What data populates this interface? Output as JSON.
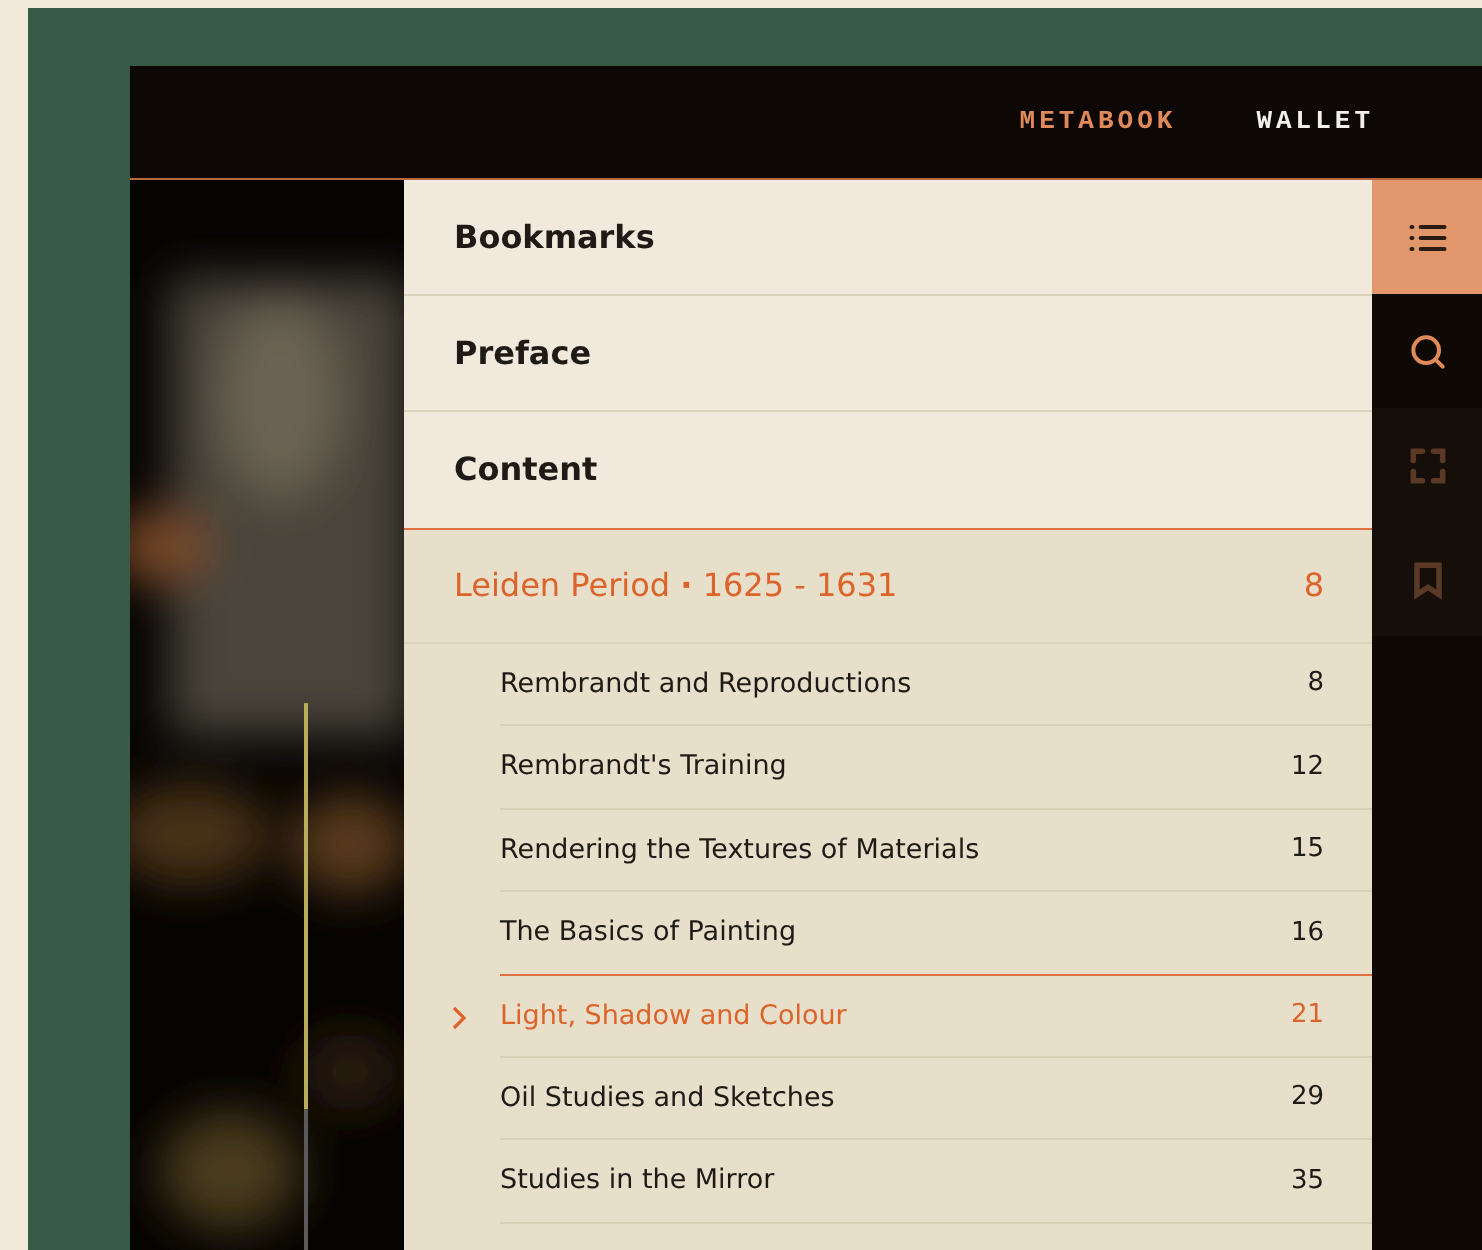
{
  "header": {
    "tabs": [
      {
        "label": "METABOOK",
        "selected": true
      },
      {
        "label": "WALLET",
        "selected": false
      }
    ]
  },
  "menu": [
    {
      "label": "Bookmarks"
    },
    {
      "label": "Preface"
    },
    {
      "label": "Content"
    }
  ],
  "section": {
    "title": "Leiden Period",
    "separator": "·",
    "dates": "1625 - 1631",
    "page": "8"
  },
  "chapters": [
    {
      "title": "Rembrandt and Reproductions",
      "page": "8",
      "selected": false
    },
    {
      "title": "Rembrandt's Training",
      "page": "12",
      "selected": false
    },
    {
      "title": "Rendering the Textures of Materials",
      "page": "15",
      "selected": false
    },
    {
      "title": "The Basics of Painting",
      "page": "16",
      "selected": false
    },
    {
      "title": "Light, Shadow and Colour",
      "page": "21",
      "selected": true
    },
    {
      "title": "Oil Studies and Sketches",
      "page": "29",
      "selected": false
    },
    {
      "title": "Studies in the Mirror",
      "page": "35",
      "selected": false
    }
  ],
  "tools": [
    {
      "kind": "contents",
      "selected": true,
      "disabled": false
    },
    {
      "kind": "search",
      "selected": false,
      "disabled": false
    },
    {
      "kind": "fullscreen",
      "selected": false,
      "disabled": true
    },
    {
      "kind": "bookmark",
      "selected": false,
      "disabled": true
    }
  ]
}
